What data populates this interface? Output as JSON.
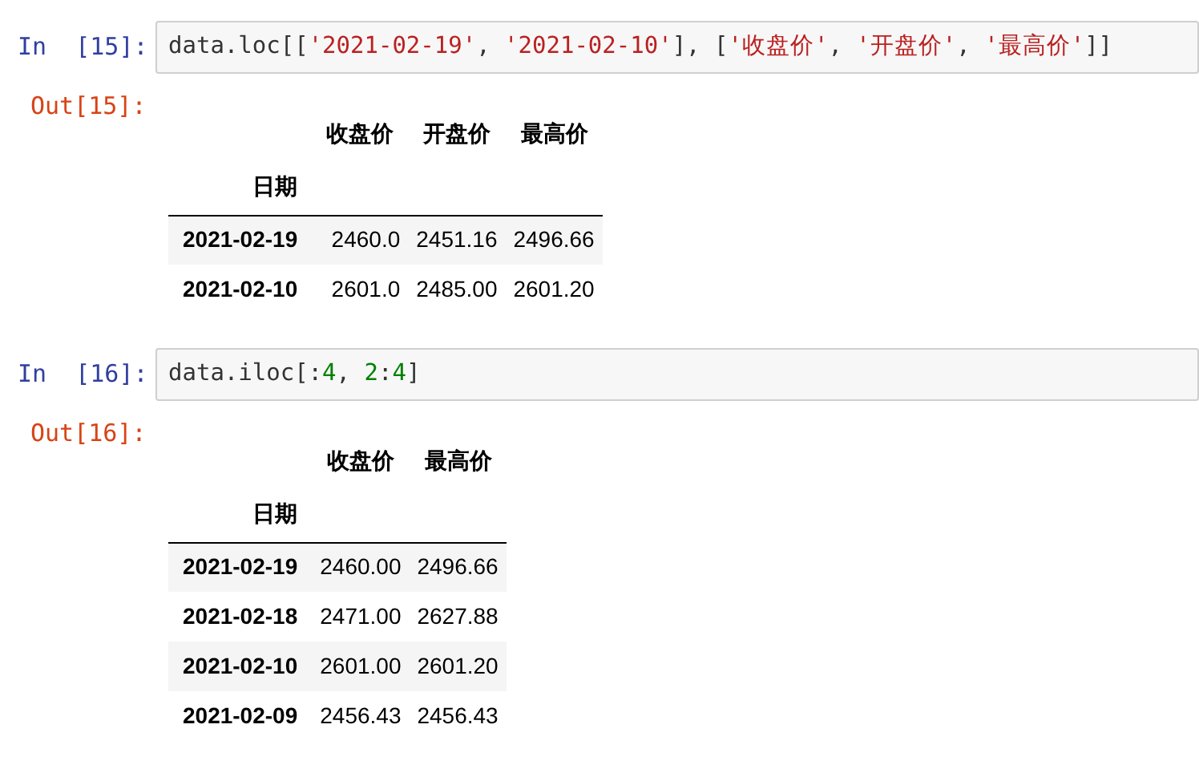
{
  "cells": [
    {
      "input_prompt": "In  [15]:",
      "code": [
        {
          "kind": "plain",
          "text": "data.loc[["
        },
        {
          "kind": "string",
          "text": "'2021-02-19'"
        },
        {
          "kind": "plain",
          "text": ", "
        },
        {
          "kind": "string",
          "text": "'2021-02-10'"
        },
        {
          "kind": "plain",
          "text": "], ["
        },
        {
          "kind": "string",
          "text": "'收盘价'"
        },
        {
          "kind": "plain",
          "text": ", "
        },
        {
          "kind": "string",
          "text": "'开盘价'"
        },
        {
          "kind": "plain",
          "text": ", "
        },
        {
          "kind": "string",
          "text": "'最高价'"
        },
        {
          "kind": "plain",
          "text": "]]"
        }
      ],
      "output_prompt": "Out[15]:",
      "table": {
        "columns": [
          "收盘价",
          "开盘价",
          "最高价"
        ],
        "index_name": "日期",
        "rows": [
          {
            "index": "2021-02-19",
            "values": [
              "2460.0",
              "2451.16",
              "2496.66"
            ]
          },
          {
            "index": "2021-02-10",
            "values": [
              "2601.0",
              "2485.00",
              "2601.20"
            ]
          }
        ]
      }
    },
    {
      "input_prompt": "In  [16]:",
      "code": [
        {
          "kind": "plain",
          "text": "data.iloc[:"
        },
        {
          "kind": "number",
          "text": "4"
        },
        {
          "kind": "plain",
          "text": ", "
        },
        {
          "kind": "number",
          "text": "2"
        },
        {
          "kind": "plain",
          "text": ":"
        },
        {
          "kind": "number",
          "text": "4"
        },
        {
          "kind": "plain",
          "text": "]"
        }
      ],
      "output_prompt": "Out[16]:",
      "table": {
        "columns": [
          "收盘价",
          "最高价"
        ],
        "index_name": "日期",
        "rows": [
          {
            "index": "2021-02-19",
            "values": [
              "2460.00",
              "2496.66"
            ]
          },
          {
            "index": "2021-02-18",
            "values": [
              "2471.00",
              "2627.88"
            ]
          },
          {
            "index": "2021-02-10",
            "values": [
              "2601.00",
              "2601.20"
            ]
          },
          {
            "index": "2021-02-09",
            "values": [
              "2456.43",
              "2456.43"
            ]
          }
        ]
      }
    }
  ]
}
